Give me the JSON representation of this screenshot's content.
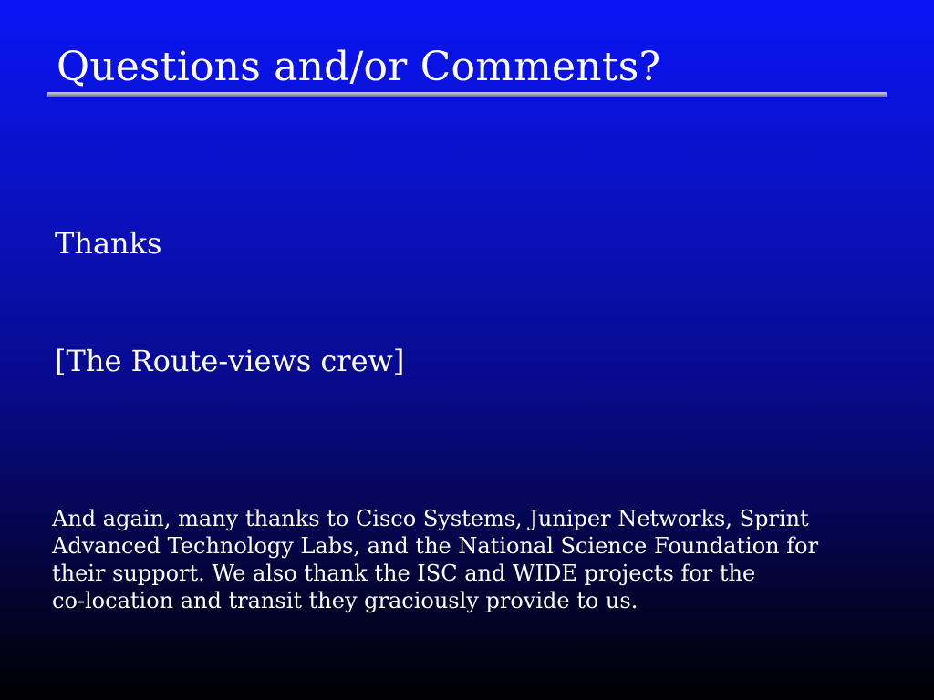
{
  "slide": {
    "title": "Questions and/or Comments?",
    "thanks": "Thanks",
    "crew": "[The Route-views crew]",
    "acknowledgement_lines": [
      "And again, many thanks to Cisco Systems, Juniper Networks, Sprint",
      "Advanced Technology Labs, and the National Science Foundation for",
      "their support. We also thank the ISC and WIDE projects for the",
      "co-location and transit they graciously provide to us."
    ]
  },
  "colors": {
    "background_top": "#0a14f5",
    "background_bottom": "#000000",
    "text": "#ffffff",
    "rule": "#a0a0b8"
  }
}
